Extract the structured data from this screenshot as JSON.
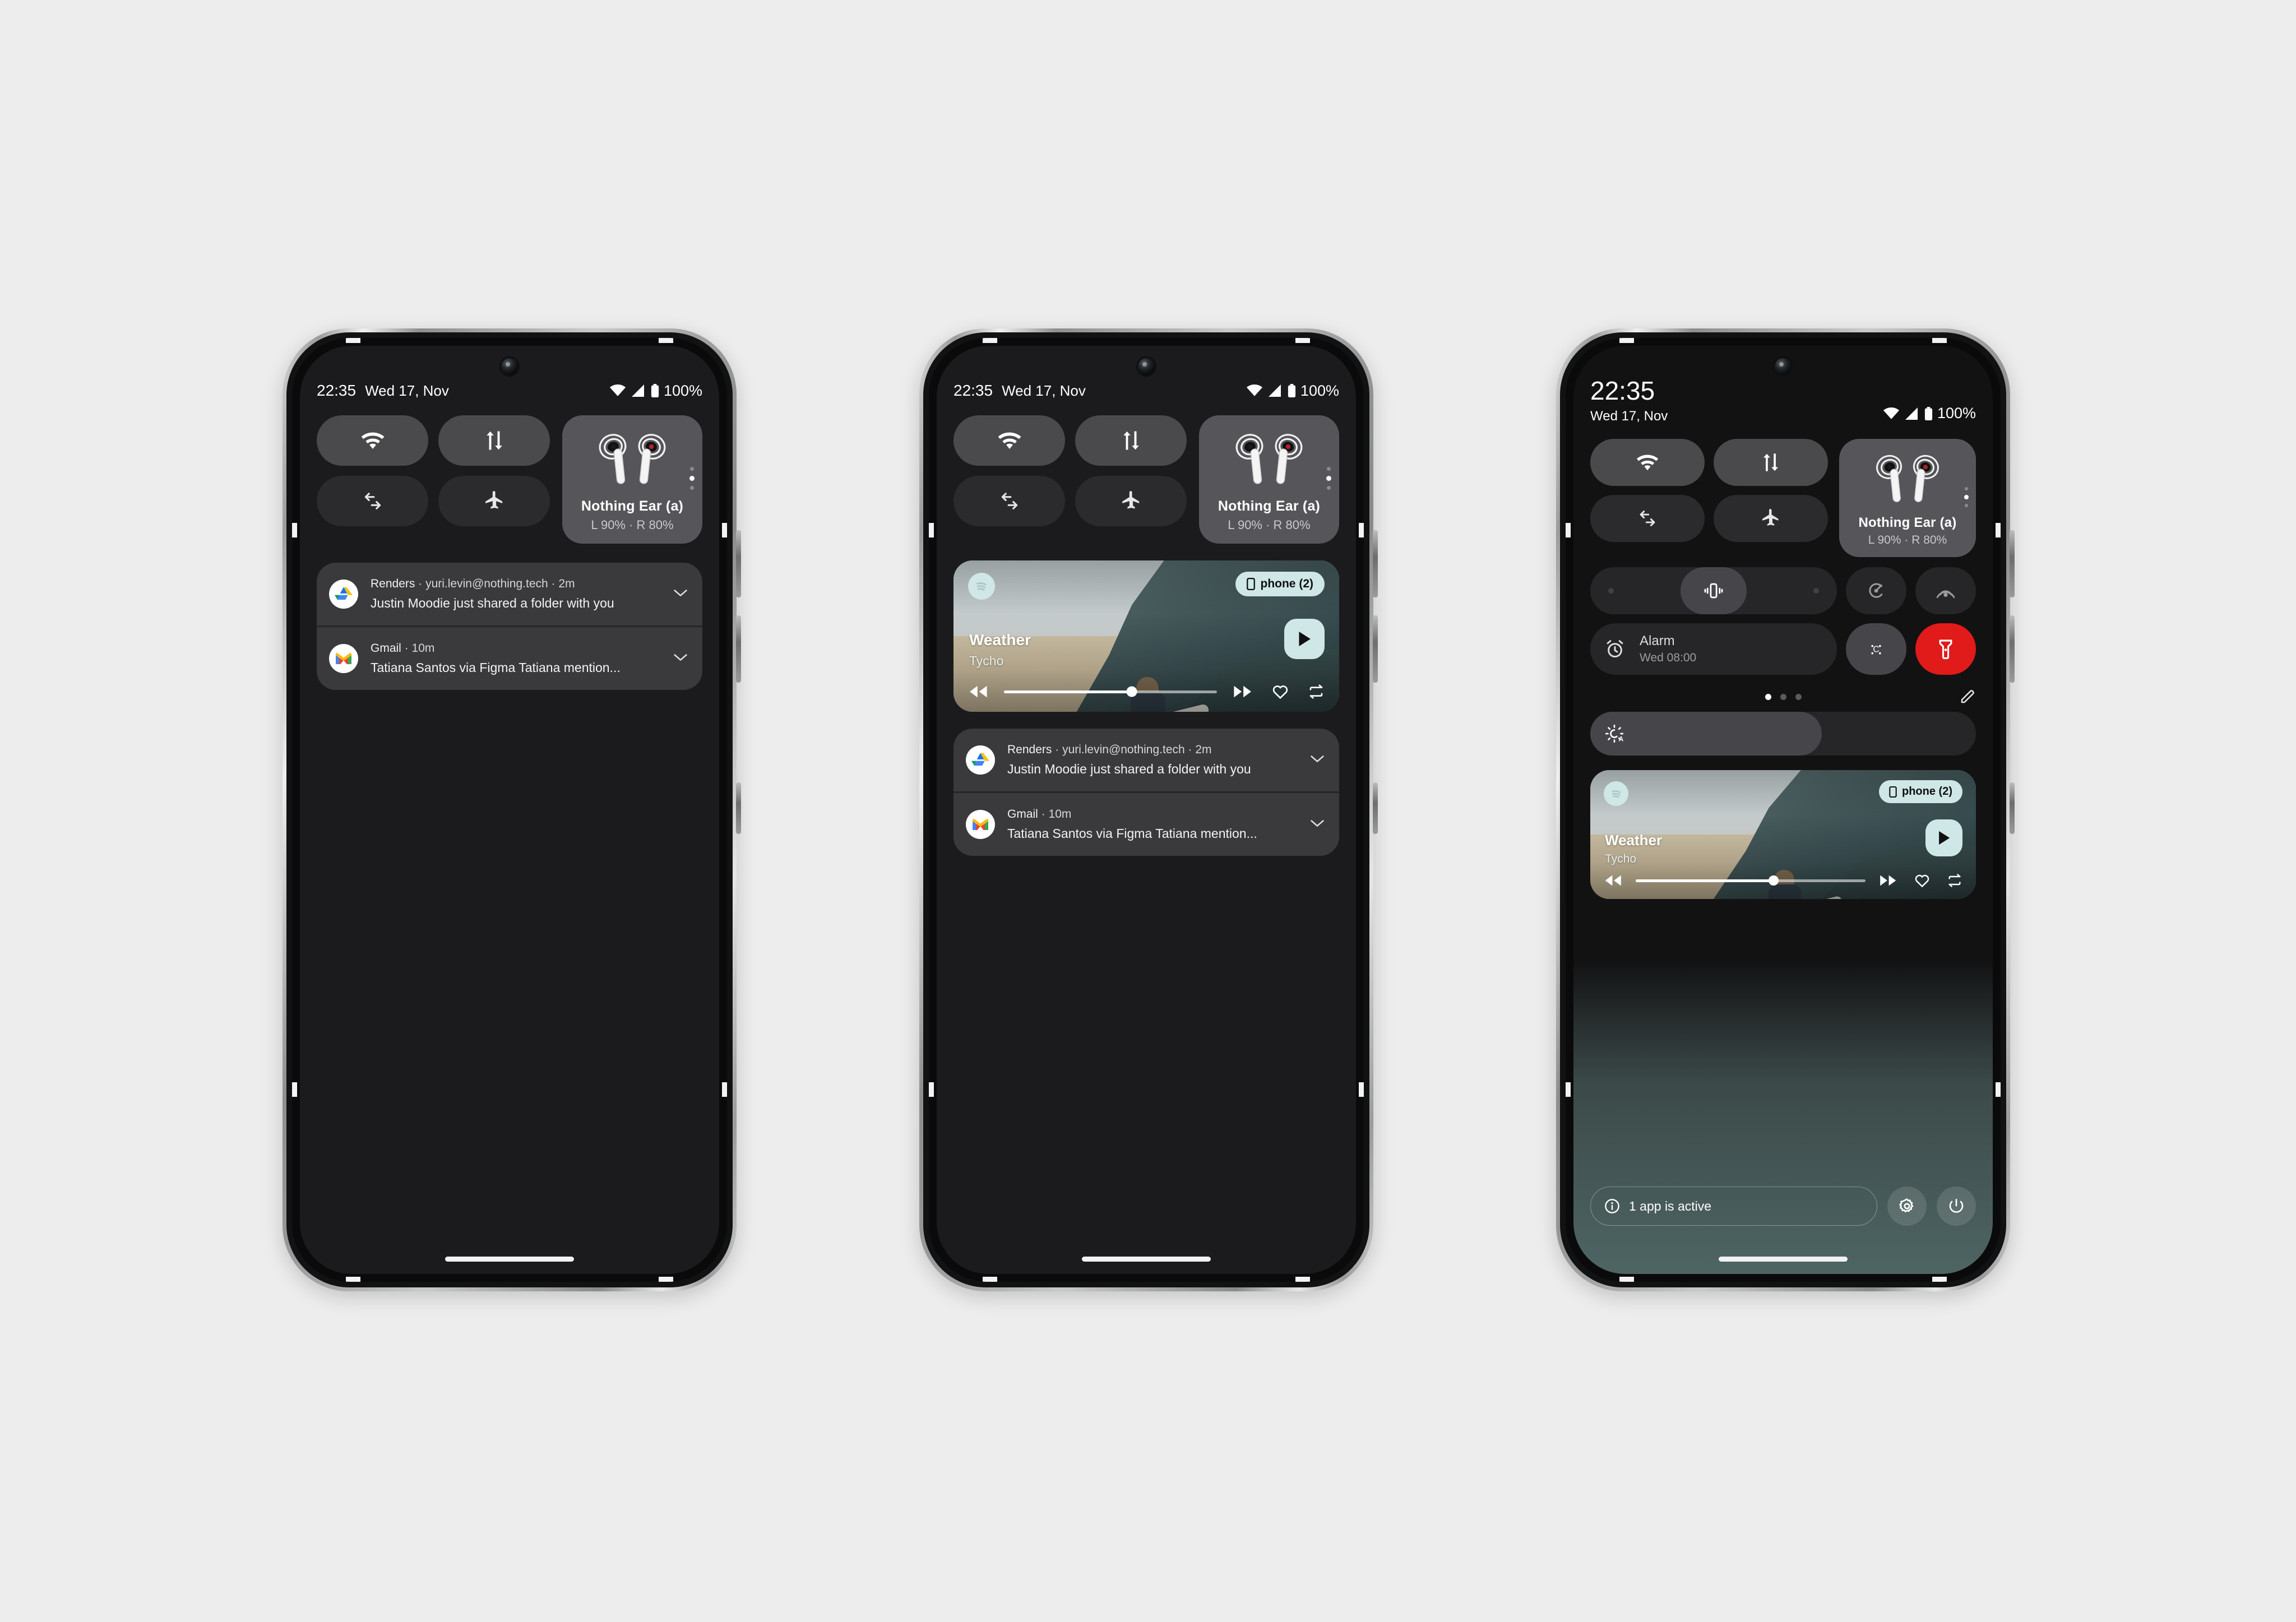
{
  "status": {
    "time": "22:35",
    "date": "Wed 17, Nov",
    "battery_percent": "100%",
    "wifi_icon": "wifi-icon",
    "signal_icon": "cellular-signal-icon",
    "battery_icon": "battery-icon"
  },
  "tiles": {
    "wifi": "wifi-tile",
    "data": "mobile-data-tile",
    "rotate": "auto-rotate-tile",
    "airplane": "airplane-mode-tile"
  },
  "device_card": {
    "name": "Nothing Ear (a)",
    "battery": "L 90% · R 80%",
    "page_dots": 3,
    "active_dot": 1
  },
  "expanded_tiles": {
    "vibrate": "vibrate-mode-tile",
    "battery_saver": "battery-saver-tile",
    "hotspot": "hotspot-tile",
    "alarm_label": "Alarm",
    "alarm_time": "Wed 08:00",
    "theme": "theme-tile",
    "flashlight": "flashlight-tile",
    "flashlight_color": "#e11a1a",
    "pager_dots": 3,
    "pager_active": 0,
    "edit": "edit-tiles-button"
  },
  "brightness": {
    "icon": "auto-brightness-icon",
    "level_percent": 60
  },
  "media": {
    "app_icon": "spotify-icon",
    "output_chip": "phone (2)",
    "chip_icon": "phone-device-icon",
    "title": "Weather",
    "artist": "Tycho",
    "play_icon": "play-icon",
    "prev_icon": "rewind-icon",
    "next_icon": "fast-forward-icon",
    "favorite_icon": "heart-icon",
    "repeat_icon": "repeat-icon",
    "progress_percent": 60,
    "accent": "#cfe7e6"
  },
  "notifications": [
    {
      "app": "Renders",
      "meta": "yuri.levin@nothing.tech",
      "time": "2m",
      "text": "Justin Moodie just shared a folder with you",
      "icon": "google-drive-icon",
      "expand_icon": "chevron-down-icon"
    },
    {
      "app": "Gmail",
      "meta": "",
      "time": "10m",
      "text": "Tatiana Santos via Figma Tatiana mention...",
      "icon": "gmail-icon",
      "expand_icon": "chevron-down-icon"
    }
  ],
  "footer": {
    "active_apps": "1 app is active",
    "info_icon": "info-icon",
    "settings_icon": "gear-icon",
    "power_icon": "power-icon"
  },
  "separators": {
    "dot": "·"
  }
}
